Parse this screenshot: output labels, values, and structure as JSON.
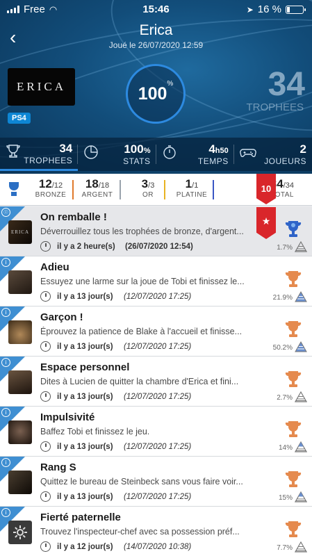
{
  "status": {
    "carrier": "Free",
    "time": "15:46",
    "battery": "16 %"
  },
  "header": {
    "title": "Erica",
    "subtitle": "Joué le 26/07/2020 12:59",
    "cover_text": "ERICA",
    "platform": "PS4",
    "completion": "100",
    "completion_unit": "%",
    "trophy_count": "34",
    "trophy_label": "TROPHEES"
  },
  "tabs": [
    {
      "value": "34",
      "unit": "",
      "label": "TROPHEES",
      "icon": "trophy-outline-icon"
    },
    {
      "value": "100",
      "unit": "%",
      "label": "STATS",
      "icon": "pie-chart-icon"
    },
    {
      "value": "4",
      "unit": "h50",
      "label": "TEMPS",
      "icon": "stopwatch-icon"
    },
    {
      "value": "2",
      "unit": "",
      "label": "JOUEURS",
      "icon": "gamepad-icon"
    }
  ],
  "summary": {
    "bronze": {
      "value": "12",
      "total": "/12",
      "label": "BRONZE",
      "color": "#e07a2c"
    },
    "argent": {
      "value": "18",
      "total": "/18",
      "label": "ARGENT",
      "color": "#9aa3ad"
    },
    "or": {
      "value": "3",
      "total": "/3",
      "label": "OR",
      "color": "#e8b322"
    },
    "platine": {
      "value": "1",
      "total": "/1",
      "label": "PLATINE",
      "color": "#3a56c4"
    },
    "total": {
      "value": "34",
      "total": "/34",
      "label": "TOTAL"
    },
    "ribbon": "10",
    "ribbon_icon": "★"
  },
  "trophies": [
    {
      "title": "On remballe !",
      "desc": "Déverrouillez tous les trophées de bronze, d'argent...",
      "ago": "il y a 2 heure(s)",
      "date": "(26/07/2020 12:54)",
      "rate": "1.7%",
      "type": "platinum"
    },
    {
      "title": "Adieu",
      "desc": "Essuyez une larme sur la joue de Tobi et finissez le...",
      "ago": "il y a 13 jour(s)",
      "date": "(12/07/2020 17:25)",
      "rate": "21.9%",
      "type": "bronze"
    },
    {
      "title": "Garçon !",
      "desc": "Éprouvez la patience de Blake à l'accueil et finisse...",
      "ago": "il y a 13 jour(s)",
      "date": "(12/07/2020 17:25)",
      "rate": "50.2%",
      "type": "bronze"
    },
    {
      "title": "Espace personnel",
      "desc": "Dites à Lucien de quitter la chambre d'Erica et fini...",
      "ago": "il y a 13 jour(s)",
      "date": "(12/07/2020 17:25)",
      "rate": "2.7%",
      "type": "bronze"
    },
    {
      "title": "Impulsivité",
      "desc": "Baffez Tobi et finissez le jeu.",
      "ago": "il y a 13 jour(s)",
      "date": "(12/07/2020 17:25)",
      "rate": "14%",
      "type": "bronze"
    },
    {
      "title": "Rang S",
      "desc": "Quittez le bureau de Steinbeck sans vous faire voir...",
      "ago": "il y a 13 jour(s)",
      "date": "(12/07/2020 17:25)",
      "rate": "15%",
      "type": "bronze"
    },
    {
      "title": "Fierté paternelle",
      "desc": "Trouvez l'inspecteur-chef avec sa possession préf...",
      "ago": "il y a 12 jour(s)",
      "date": "(14/07/2020 10:38)",
      "rate": "7.7%",
      "type": "bronze"
    }
  ]
}
